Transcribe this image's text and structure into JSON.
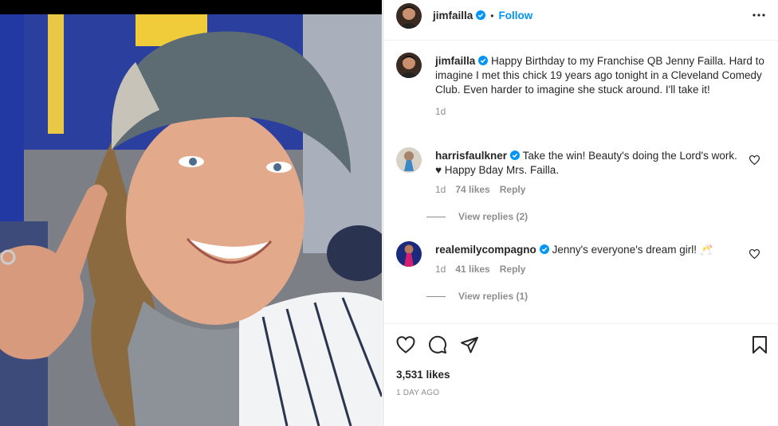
{
  "post": {
    "author": "jimfailla",
    "follow_label": "Follow",
    "separator": "•",
    "caption": {
      "username": "jimfailla",
      "text": "Happy Birthday to my Franchise QB Jenny Failla. Hard to imagine I met this chick 19 years ago tonight in a Cleveland Comedy Club. Even harder to imagine she stuck around. I'll take it!",
      "time": "1d"
    },
    "comments": [
      {
        "username": "harrisfaulkner",
        "text": "Take the win! Beauty's doing the Lord's work. ♥ Happy Bday Mrs. Failla.",
        "time": "1d",
        "likes": "74 likes",
        "reply_label": "Reply",
        "view_replies": "View replies (2)"
      },
      {
        "username": "realemilycompagno",
        "text": "Jenny's everyone's dream girl! 🥂",
        "time": "1d",
        "likes": "41 likes",
        "reply_label": "Reply",
        "view_replies": "View replies (1)"
      }
    ],
    "like_count": "3,531 likes",
    "date": "1 DAY AGO",
    "icons": [
      "heart-icon",
      "comment-icon",
      "share-icon",
      "bookmark-icon",
      "more-options-icon",
      "verified-badge-icon"
    ],
    "colors": {
      "link": "#0095f6",
      "verified": "#0095f6",
      "muted": "#8e8e8e",
      "text": "#262626"
    }
  }
}
